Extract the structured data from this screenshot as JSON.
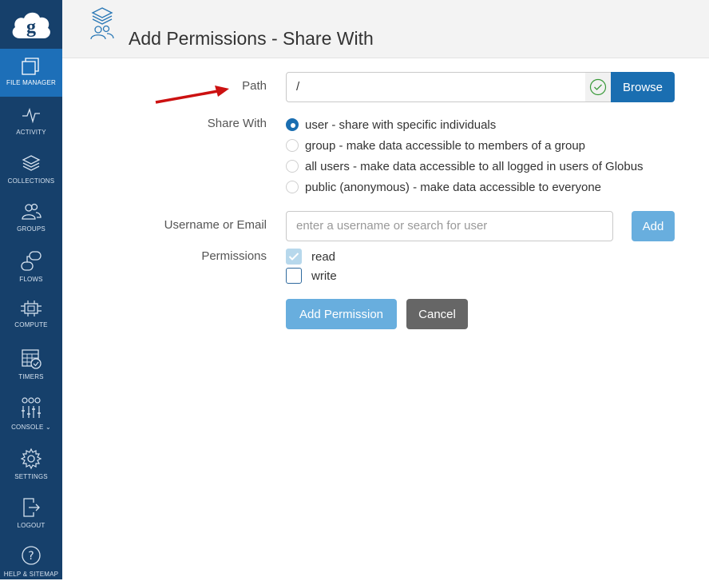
{
  "sidebar": {
    "items": [
      {
        "label": "FILE MANAGER",
        "icon": "file-manager-icon",
        "active": true
      },
      {
        "label": "ACTIVITY",
        "icon": "activity-icon"
      },
      {
        "label": "COLLECTIONS",
        "icon": "collections-icon"
      },
      {
        "label": "GROUPS",
        "icon": "groups-icon"
      },
      {
        "label": "FLOWS",
        "icon": "flows-icon"
      },
      {
        "label": "COMPUTE",
        "icon": "compute-icon"
      },
      {
        "label": "TIMERS",
        "icon": "timers-icon"
      },
      {
        "label": "CONSOLE",
        "icon": "console-icon"
      },
      {
        "label": "SETTINGS",
        "icon": "gear-icon"
      },
      {
        "label": "LOGOUT",
        "icon": "logout-icon"
      },
      {
        "label": "HELP & SITEMAP",
        "icon": "help-icon"
      }
    ]
  },
  "header": {
    "title": "Add Permissions - Share With"
  },
  "form": {
    "path_label": "Path",
    "path_value": "/",
    "browse_label": "Browse",
    "share_with_label": "Share With",
    "share_options": [
      {
        "label": "user - share with specific individuals",
        "checked": true
      },
      {
        "label": "group - make data accessible to members of a group",
        "checked": false
      },
      {
        "label": "all users - make data accessible to all logged in users of Globus",
        "checked": false
      },
      {
        "label": "public (anonymous) - make data accessible to everyone",
        "checked": false
      }
    ],
    "username_label": "Username or Email",
    "username_placeholder": "enter a username or search for user",
    "add_label": "Add",
    "permissions_label": "Permissions",
    "permissions": [
      {
        "label": "read",
        "checked": true
      },
      {
        "label": "write",
        "checked": false
      }
    ],
    "add_permission_label": "Add Permission",
    "cancel_label": "Cancel"
  },
  "colors": {
    "sidebar_bg": "#16406b",
    "sidebar_active": "#1d6fb8",
    "primary": "#1a6eb1",
    "primary_light": "#68aede",
    "annotation_arrow": "#cc1111"
  }
}
